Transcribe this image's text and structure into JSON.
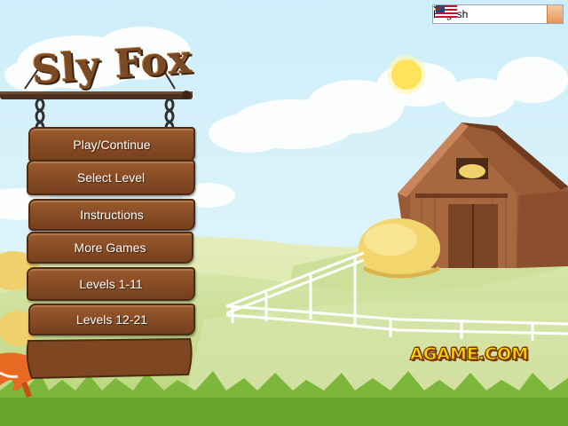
{
  "language_selector": {
    "selected": "English",
    "flag_icon": "us-flag-icon"
  },
  "title": "Sly Fox",
  "menu": {
    "play": "Play/Continue",
    "select_level": "Select Level",
    "instructions": "Instructions",
    "more_games": "More Games",
    "levels_1": "Levels 1-11",
    "levels_2": "Levels 12-21"
  },
  "brand": "AGAME.COM",
  "colors": {
    "sky": "#bfe6f5",
    "grass": "#8dbf3a",
    "wood": "#8a4e26",
    "barn": "#a0603a",
    "logo": "#ffd400"
  }
}
